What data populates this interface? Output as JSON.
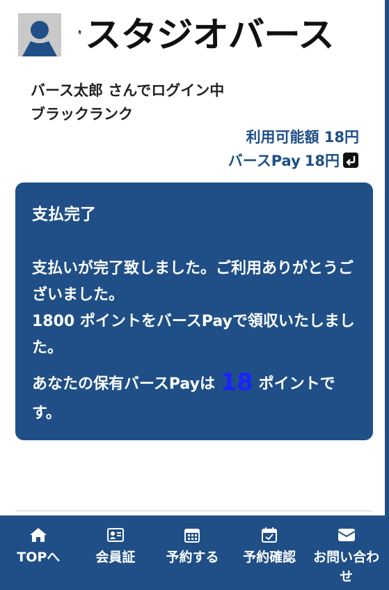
{
  "header": {
    "logo_text": "スタジオバース",
    "login_status": "バース太郎 さんでログイン中",
    "rank": "ブラックランク",
    "available_amount": "利用可能額 18円",
    "pay_label": "バースPay",
    "pay_amount": "18円"
  },
  "card": {
    "title": "支払完了",
    "message_1": "支払いが完了致しました。ご利用ありがとうございました。",
    "message_2": "1800 ポイントをバースPayで領収いたしました。",
    "balance_prefix": "あなたの保有バースPayは",
    "balance_value": "18",
    "balance_suffix": "ポイントです。"
  },
  "nav": {
    "items": [
      {
        "label": "TOPへ",
        "icon": "home-icon"
      },
      {
        "label": "会員証",
        "icon": "id-card-icon"
      },
      {
        "label": "予約する",
        "icon": "calendar-icon"
      },
      {
        "label": "予約確認",
        "icon": "calendar-check-icon"
      },
      {
        "label": "お問い合わせ",
        "icon": "envelope-icon"
      }
    ]
  },
  "colors": {
    "brand": "#1f4f86",
    "highlight_number": "#1a22ff",
    "text_dark": "#222222"
  }
}
